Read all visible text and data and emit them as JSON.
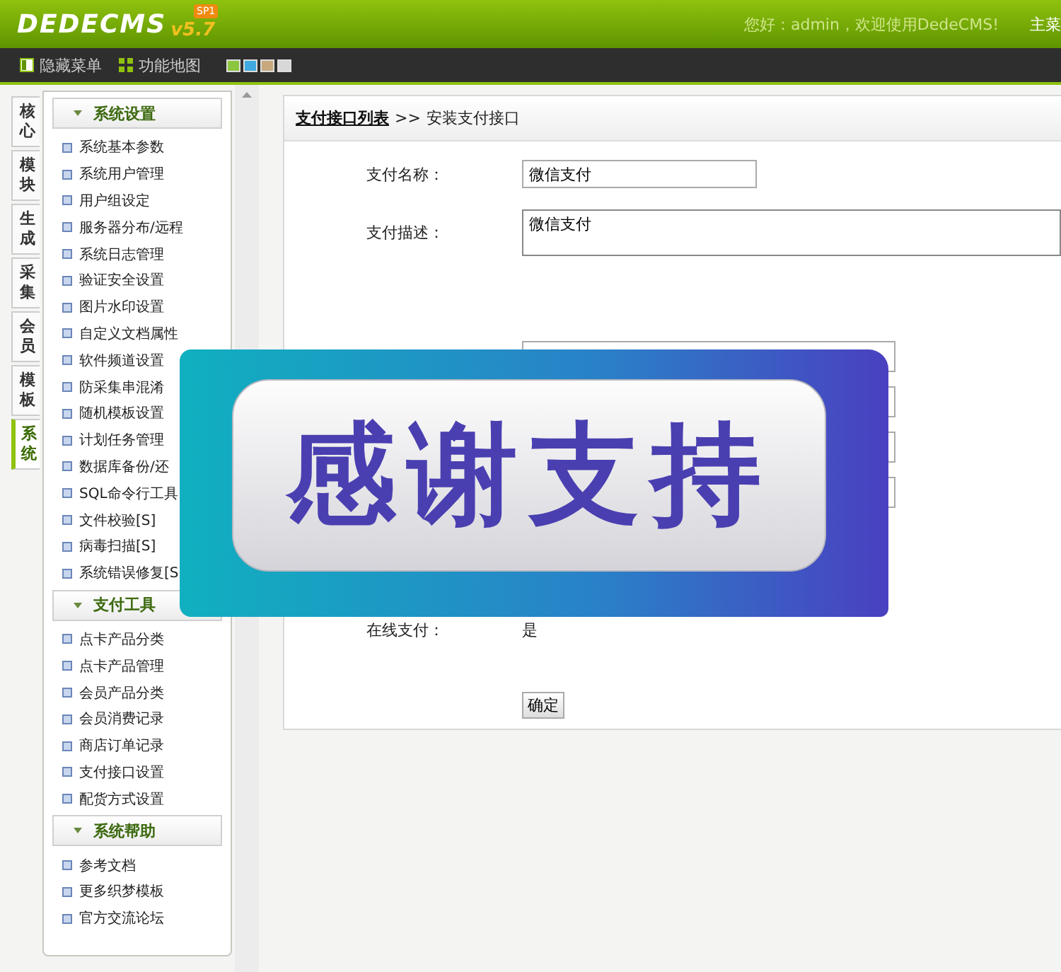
{
  "header": {
    "logo": "DEDECMS",
    "version": "v5.7",
    "edition": "SP1",
    "greeting": "您好：admin，欢迎使用DedeCMS!",
    "main_menu": "主菜"
  },
  "toolbar": {
    "items": [
      {
        "kind": "hide",
        "label": "隐藏菜单"
      },
      {
        "kind": "map",
        "label": "功能地图"
      }
    ],
    "skins": [
      {
        "color": "#8cc63f"
      },
      {
        "color": "#3fa9e0"
      },
      {
        "color": "#c8a97e"
      },
      {
        "color": "#d8d8d8"
      }
    ]
  },
  "side_tabs": [
    {
      "label": "核心",
      "selected": false
    },
    {
      "label": "模块",
      "selected": false
    },
    {
      "label": "生成",
      "selected": false
    },
    {
      "label": "采集",
      "selected": false
    },
    {
      "label": "会员",
      "selected": false
    },
    {
      "label": "模板",
      "selected": false
    },
    {
      "label": "系统",
      "selected": true
    }
  ],
  "sidebar": {
    "groups": [
      {
        "title": "系统设置",
        "items": [
          "系统基本参数",
          "系统用户管理",
          "用户组设定",
          "服务器分布/远程",
          "系统日志管理",
          "验证安全设置",
          "图片水印设置",
          "自定义文档属性",
          "软件频道设置",
          "防采集串混淆",
          "随机模板设置",
          "计划任务管理",
          "数据库备份/还",
          "SQL命令行工具",
          "文件校验[S]",
          "病毒扫描[S]",
          "系统错误修复[S"
        ]
      },
      {
        "title": "支付工具",
        "items": [
          "点卡产品分类",
          "点卡产品管理",
          "会员产品分类",
          "会员消费记录",
          "商店订单记录",
          "支付接口设置",
          "配货方式设置"
        ]
      },
      {
        "title": "系统帮助",
        "items": [
          "参考文档",
          "更多织梦模板",
          "官方交流论坛"
        ]
      }
    ]
  },
  "breadcrumb": {
    "link": "支付接口列表",
    "separator": ">>",
    "current": "安装支付接口"
  },
  "form": {
    "rows": [
      {
        "kind": "input",
        "label": "支付名称：",
        "value": "微信支付"
      },
      {
        "kind": "textarea",
        "label": "支付描述：",
        "value": "微信支付"
      },
      {
        "kind": "blank"
      },
      {
        "kind": "blank"
      },
      {
        "kind": "blank"
      },
      {
        "kind": "blank"
      },
      {
        "kind": "text",
        "label": "在线支付：",
        "value": "是"
      }
    ],
    "submit": "确定"
  },
  "banner": {
    "text": "感谢支持"
  }
}
